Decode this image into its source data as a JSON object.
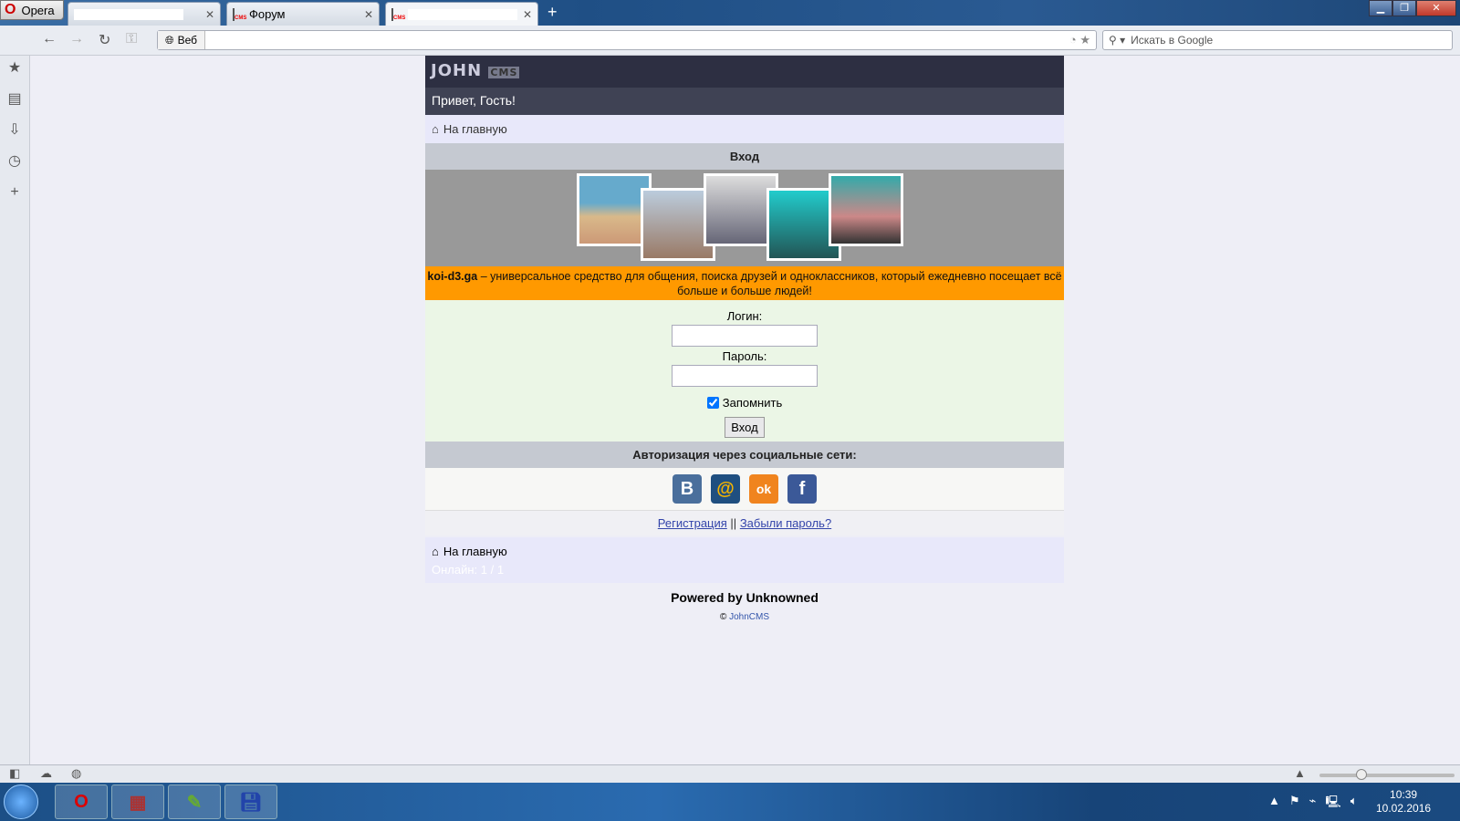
{
  "browser": {
    "menu_label": "Opera",
    "tabs": [
      {
        "title": ""
      },
      {
        "title": "Форум"
      },
      {
        "title": ""
      }
    ],
    "address_prefix": "Веб",
    "url": "",
    "search_placeholder": "Искать в Google"
  },
  "site": {
    "logo": "JOHN",
    "logo_sub": "CMS",
    "greeting": "Привет, Гость!",
    "home_link": "На главную",
    "login_header": "Вход",
    "promo_site": "koi-d3.ga",
    "promo_text": " – универсальное средство для общения, поиска друзей и одноклассников, который ежедневно посещает всё больше и больше людей!",
    "login_label": "Логин:",
    "login_value": "",
    "password_label": "Пароль:",
    "password_value": "",
    "remember_label": "Запомнить",
    "remember_checked": true,
    "submit_label": "Вход",
    "social_header": "Авторизация через социальные сети:",
    "social": [
      {
        "name": "vk",
        "glyph": "B",
        "color": "#4a6f9c"
      },
      {
        "name": "mailru",
        "glyph": "@",
        "color": "#1f4f80"
      },
      {
        "name": "odnoklassniki",
        "glyph": "ok",
        "color": "#f0841e"
      },
      {
        "name": "facebook",
        "glyph": "f",
        "color": "#3b5998"
      }
    ],
    "register_link": "Регистрация",
    "separator": "||",
    "forgot_link": "Забыли пароль?",
    "online": "Онлайн: 1 / 1",
    "powered": "Powered by Unknowned",
    "copyright_symbol": "©",
    "copyright_link": "JohnCMS"
  },
  "taskbar": {
    "time": "10:39",
    "date": "10.02.2016"
  }
}
